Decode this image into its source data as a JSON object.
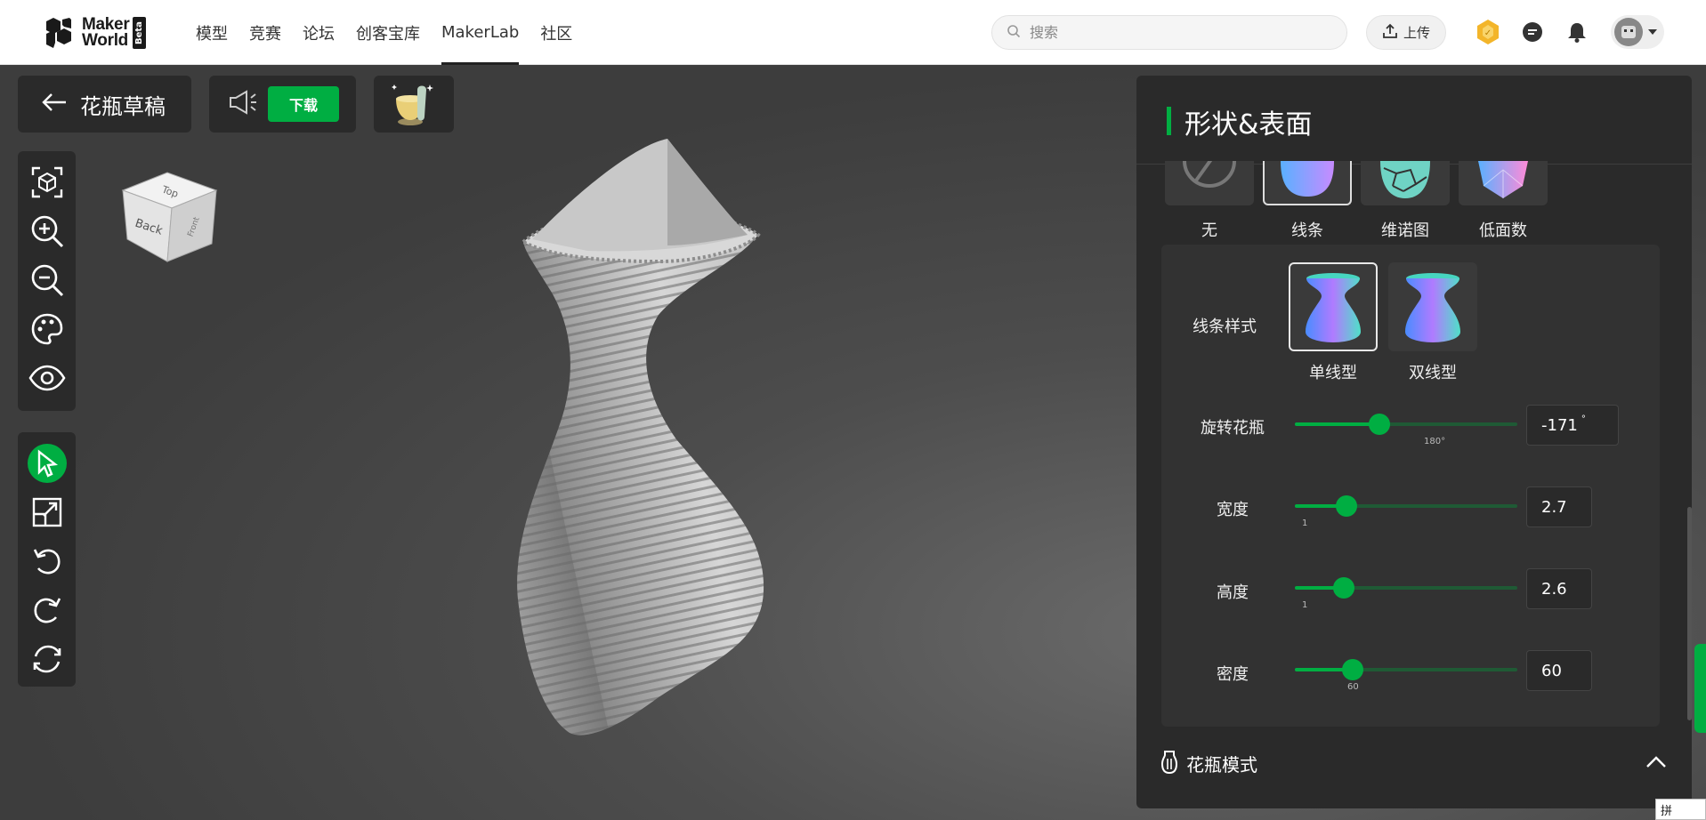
{
  "nav": {
    "logo_line1": "Maker",
    "logo_line2": "World",
    "beta": "Beta",
    "items": [
      "模型",
      "竞赛",
      "论坛",
      "创客宝库",
      "MakerLab",
      "社区"
    ],
    "active_item": "MakerLab"
  },
  "search": {
    "placeholder": "搜索"
  },
  "upload": {
    "label": "上传"
  },
  "project": {
    "title": "花瓶草稿",
    "download_label": "下载"
  },
  "view_cube": {
    "face_front": "Back",
    "face_top": "Top",
    "face_side": "Front"
  },
  "left_toolbar": {
    "top_tools": [
      "fit-view-icon",
      "zoom-in-icon",
      "zoom-out-icon",
      "palette-icon",
      "eye-icon"
    ],
    "bottom_tools": [
      "select-icon",
      "scale-icon",
      "undo-icon",
      "redo-icon",
      "reset-icon"
    ],
    "selected_tool": "select-icon"
  },
  "panel": {
    "title": "形状&表面",
    "surface_effects": [
      {
        "label": "无",
        "selected": false
      },
      {
        "label": "线条",
        "selected": true
      },
      {
        "label": "维诺图",
        "selected": false
      },
      {
        "label": "低面数",
        "selected": false
      }
    ],
    "line_style": {
      "label": "线条样式",
      "options": [
        {
          "label": "单线型",
          "selected": true
        },
        {
          "label": "双线型",
          "selected": false
        }
      ]
    },
    "rotate": {
      "label": "旋转花瓶",
      "value": "-171",
      "unit": "°",
      "mark": "180°",
      "fraction": 0.38
    },
    "width": {
      "label": "宽度",
      "value": "2.7",
      "mark": "1",
      "fraction": 0.23
    },
    "height": {
      "label": "高度",
      "value": "2.6",
      "mark": "1",
      "fraction": 0.22
    },
    "density": {
      "label": "密度",
      "value": "60",
      "mark": "60",
      "fraction": 0.26
    },
    "vase_mode": {
      "label": "花瓶模式"
    }
  },
  "ime": {
    "label": "拼"
  },
  "colors": {
    "accent": "#00ae42",
    "panel_bg": "#2a2a2a",
    "viewport_bg": "#3e3e3e"
  }
}
